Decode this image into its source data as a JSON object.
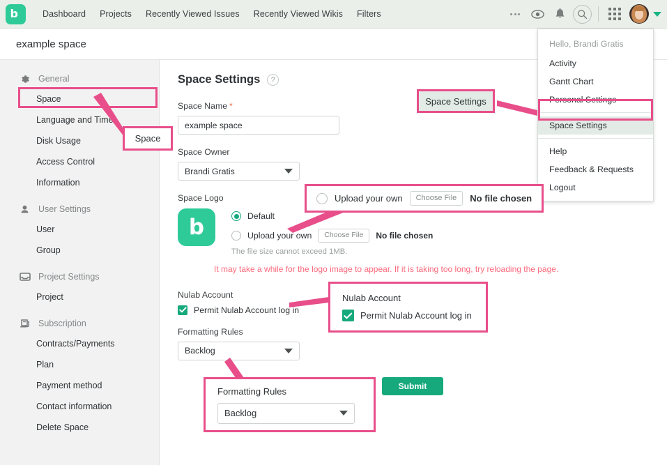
{
  "topnav": {
    "logo_icon": "backlog-logo-icon",
    "links": [
      "Dashboard",
      "Projects",
      "Recently Viewed Issues",
      "Recently Viewed Wikis",
      "Filters"
    ],
    "icons": [
      "more-ellipsis-icon",
      "eye-icon",
      "bell-icon",
      "search-icon",
      "apps-grid-icon",
      "avatar",
      "chevron-down-icon"
    ]
  },
  "spacebar": {
    "title": "example space"
  },
  "sidebar": {
    "groups": [
      {
        "label": "General",
        "icon": "gear-icon",
        "items": [
          "Space",
          "Language and Time",
          "Disk Usage",
          "Access Control",
          "Information"
        ]
      },
      {
        "label": "User Settings",
        "icon": "user-icon",
        "items": [
          "User",
          "Group"
        ]
      },
      {
        "label": "Project Settings",
        "icon": "inbox-icon",
        "items": [
          "Project"
        ]
      },
      {
        "label": "Subscription",
        "icon": "scroll-icon",
        "items": [
          "Contracts/Payments",
          "Plan",
          "Payment method",
          "Contact information",
          "Delete Space"
        ]
      }
    ]
  },
  "main": {
    "page_title": "Space Settings",
    "help_icon": "question-mark-icon",
    "space_name": {
      "label": "Space Name",
      "required_mark": "*",
      "value": "example space"
    },
    "space_owner": {
      "label": "Space Owner",
      "value": "Brandi Gratis"
    },
    "space_logo": {
      "label": "Space Logo",
      "logo_icon": "backlog-logo-icon",
      "option_default": "Default",
      "option_upload": "Upload your own",
      "choose_file_button": "Choose File",
      "no_file_text": "No file chosen",
      "hint": "The file size cannot exceed 1MB.",
      "warning": "It may take a while for the logo image to appear. If it is taking too long, try reloading the page.",
      "selected": "Default"
    },
    "nulab_account": {
      "label": "Nulab Account",
      "checkbox_label": "Permit Nulab Account log in",
      "checked": true
    },
    "formatting_rules": {
      "label": "Formatting Rules",
      "value": "Backlog"
    },
    "submit_button": "Submit"
  },
  "dropdown": {
    "greeting": "Hello, Brandi Gratis",
    "items_top": [
      "Activity",
      "Gantt Chart",
      "Personal Settings"
    ],
    "highlighted": "Space Settings",
    "items_bottom": [
      "Help",
      "Feedback & Requests",
      "Logout"
    ]
  },
  "annotations": {
    "accent_color": "#e84f8a",
    "callout_space": "Space",
    "callout_space_settings": "Space Settings",
    "callout_upload": {
      "radio_label": "Upload your own",
      "choose_file": "Choose File",
      "no_file": "No file chosen"
    },
    "callout_nulab": {
      "title": "Nulab Account",
      "checkbox_label": "Permit Nulab Account log in"
    },
    "callout_formatting": {
      "title": "Formatting Rules",
      "value": "Backlog"
    }
  }
}
